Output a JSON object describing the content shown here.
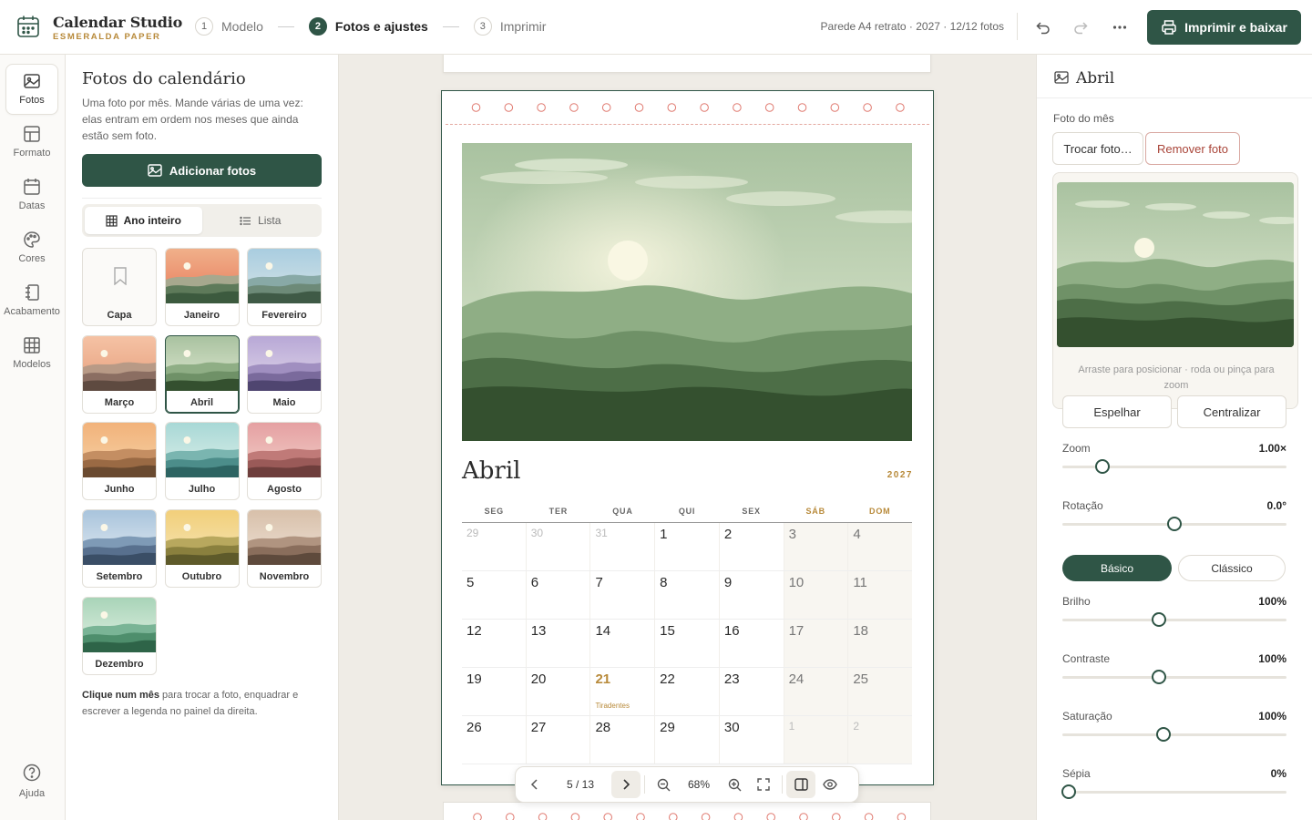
{
  "app": {
    "name": "Calendar Studio",
    "subtitle": "ESMERALDA PAPER"
  },
  "steps": [
    {
      "num": "1",
      "label": "Modelo",
      "active": false
    },
    {
      "num": "2",
      "label": "Fotos e ajustes",
      "active": true
    },
    {
      "num": "3",
      "label": "Imprimir",
      "active": false
    }
  ],
  "header": {
    "doc_info": "Parede A4 retrato · 2027 · 12/12 fotos",
    "print_button": "Imprimir e baixar"
  },
  "rail": {
    "items": [
      {
        "label": "Fotos",
        "icon": "image-icon"
      },
      {
        "label": "Formato",
        "icon": "layout-icon"
      },
      {
        "label": "Datas",
        "icon": "calendar-icon"
      },
      {
        "label": "Cores",
        "icon": "palette-icon"
      },
      {
        "label": "Acabamento",
        "icon": "binding-icon"
      },
      {
        "label": "Modelos",
        "icon": "grid-icon"
      }
    ],
    "help": "Ajuda"
  },
  "left_panel": {
    "title": "Fotos do calendário",
    "description": "Uma foto por mês. Mande várias de uma vez: elas entram em ordem nos meses que ainda estão sem foto.",
    "add_button": "Adicionar fotos",
    "view_tabs": [
      "Ano inteiro",
      "Lista"
    ],
    "thumbs": [
      "Capa",
      "Janeiro",
      "Fevereiro",
      "Março",
      "Abril",
      "Maio",
      "Junho",
      "Julho",
      "Agosto",
      "Setembro",
      "Outubro",
      "Novembro",
      "Dezembro"
    ],
    "selected": "Abril",
    "hint_bold": "Clique num mês",
    "hint_rest": " para trocar a foto, enquadrar e escrever a legenda no painel da direita."
  },
  "page": {
    "month": "Abril",
    "year": "2027",
    "weekdays": [
      "SEG",
      "TER",
      "QUA",
      "QUI",
      "SEX",
      "SÁB",
      "DOM"
    ],
    "weeks": [
      [
        "29",
        "30",
        "31",
        "1",
        "2",
        "3",
        "4"
      ],
      [
        "5",
        "6",
        "7",
        "8",
        "9",
        "10",
        "11"
      ],
      [
        "12",
        "13",
        "14",
        "15",
        "16",
        "17",
        "18"
      ],
      [
        "19",
        "20",
        "21",
        "22",
        "23",
        "24",
        "25"
      ],
      [
        "26",
        "27",
        "28",
        "29",
        "30",
        "1",
        "2"
      ]
    ],
    "holiday_note": "Tiradentes"
  },
  "toolbar": {
    "page_indicator": "5 / 13",
    "zoom": "68%"
  },
  "right_panel": {
    "title": "Abril",
    "photo_label": "Foto do mês",
    "replace_button": "Trocar foto…",
    "remove_button": "Remover foto",
    "drag_hint": "Arraste para posicionar · roda ou pinça para zoom",
    "mirror_button": "Espelhar",
    "center_button": "Centralizar",
    "zoom": {
      "label": "Zoom",
      "value": "1.00×",
      "level": 0.18
    },
    "rotation": {
      "label": "Rotação",
      "value": "0.0°",
      "level": 0.5
    },
    "mode_tabs": [
      "Básico",
      "Clássico"
    ],
    "brightness": {
      "label": "Brilho",
      "value": "100%",
      "level": 0.43
    },
    "contrast": {
      "label": "Contraste",
      "value": "100%",
      "level": 0.43
    },
    "saturation": {
      "label": "Saturação",
      "value": "100%",
      "level": 0.45
    },
    "sepia": {
      "label": "Sépia",
      "value": "0%",
      "level": 0.03
    }
  },
  "colors": {
    "accent": "#2f5546",
    "gold": "#b88a3a",
    "danger": "#a94438"
  }
}
